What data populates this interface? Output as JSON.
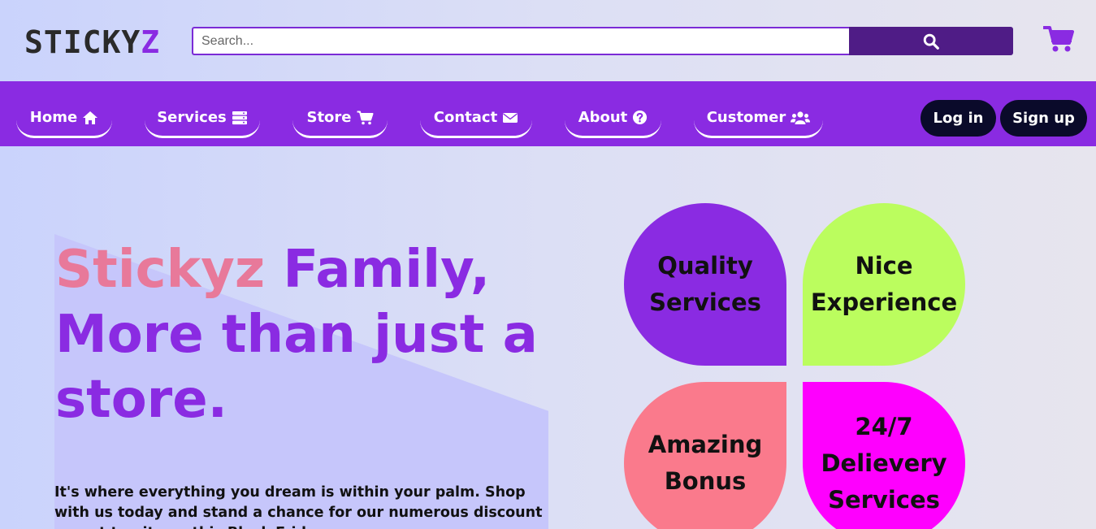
{
  "header": {
    "logo_main": "STICKY",
    "logo_accent": "Z",
    "search_placeholder": "Search...",
    "search_icon": "search-icon",
    "cart_icon": "cart-icon"
  },
  "nav": {
    "items": [
      {
        "label": "Home",
        "icon": "home-icon"
      },
      {
        "label": "Services",
        "icon": "server-icon"
      },
      {
        "label": "Store",
        "icon": "cart-icon"
      },
      {
        "label": "Contact",
        "icon": "envelope-icon"
      },
      {
        "label": "About",
        "icon": "question-circle-icon"
      },
      {
        "label": "Customer",
        "icon": "users-icon"
      }
    ],
    "login_label": "Log in",
    "signup_label": "Sign up"
  },
  "hero": {
    "headline_accent": "Stickyz",
    "headline_rest_1": " Family,",
    "headline_rest_2": "More than just a store.",
    "intro": "It's where everything you dream is within your palm. Shop with us today and stand a chance for our numerous discount on out top items this Black Friday."
  },
  "features": [
    {
      "label": "Quality Services",
      "color": "#8a2be2"
    },
    {
      "label": "Nice Experience",
      "color": "#bbfd5e"
    },
    {
      "label": "Amazing Bonus",
      "color": "#fa7a8c"
    },
    {
      "label": "24/7 Delievery Services",
      "color": "#fe00fe"
    }
  ],
  "colors": {
    "brand": "#8a2be2",
    "search_button": "#4f1c86",
    "auth_button": "#0a0a2a",
    "accent_pink": "#e8799a"
  }
}
